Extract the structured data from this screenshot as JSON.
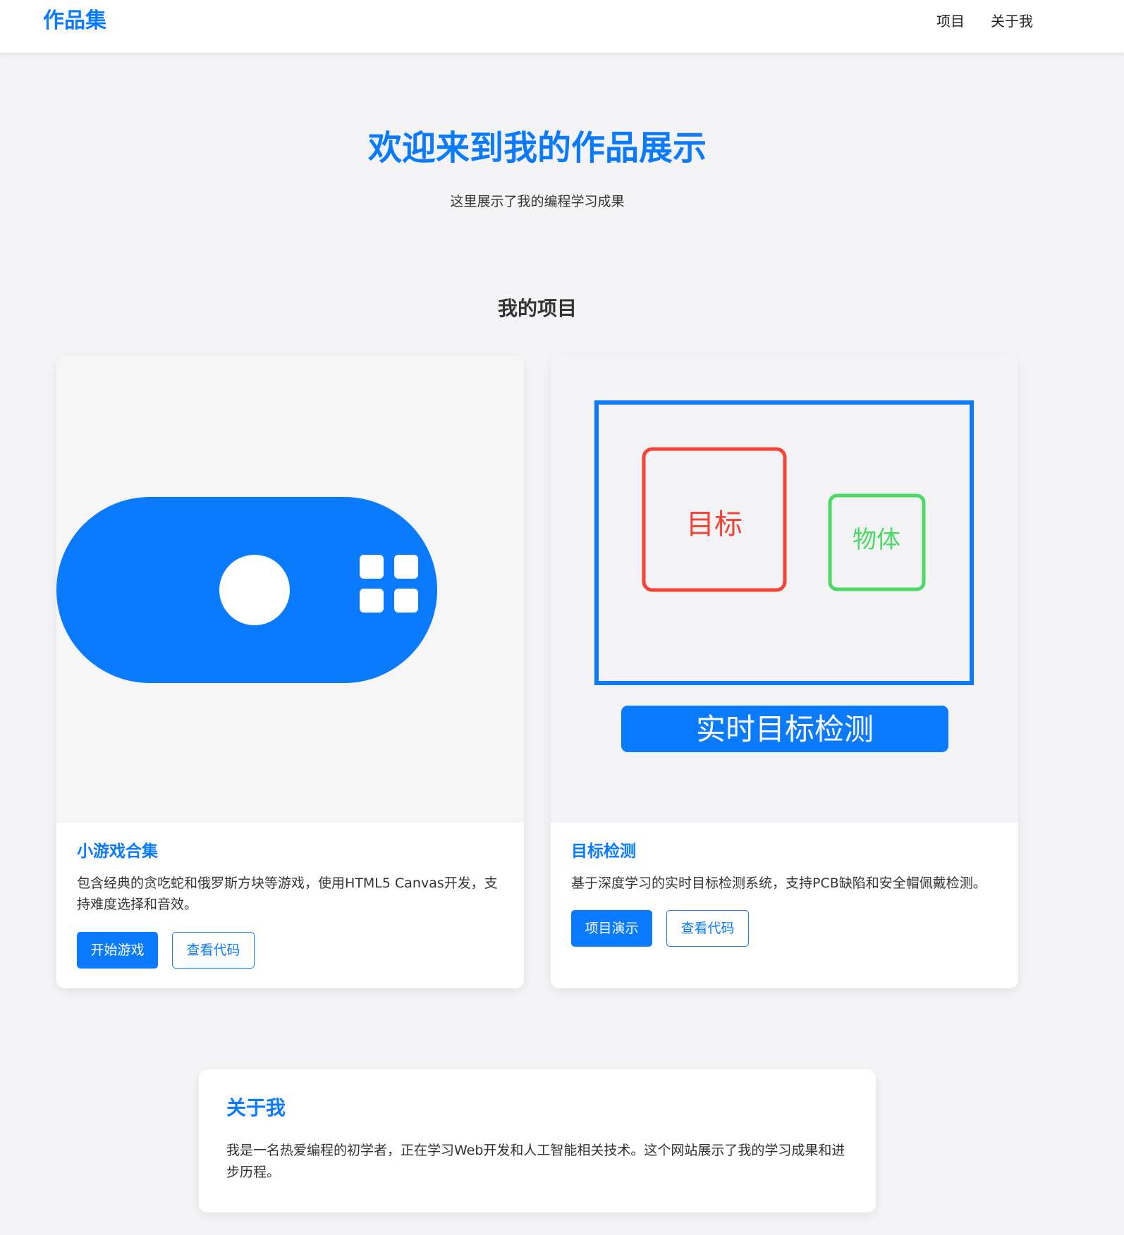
{
  "header": {
    "brand": "作品集",
    "nav": {
      "projects": "项目",
      "about": "关于我"
    }
  },
  "hero": {
    "title": "欢迎来到我的作品展示",
    "subtitle": "这里展示了我的编程学习成果"
  },
  "projects_section": {
    "title": "我的项目",
    "cards": [
      {
        "image_icon": "gamepad-icon",
        "title": "小游戏合集",
        "description": "包含经典的贪吃蛇和俄罗斯方块等游戏，使用HTML5 Canvas开发，支持难度选择和音效。",
        "primary_button": "开始游戏",
        "secondary_button": "查看代码"
      },
      {
        "image_icon": "object-detection-illustration",
        "illustration": {
          "target_label": "目标",
          "object_label": "物体",
          "banner": "实时目标检测"
        },
        "title": "目标检测",
        "description": "基于深度学习的实时目标检测系统，支持PCB缺陷和安全帽佩戴检测。",
        "primary_button": "项目演示",
        "secondary_button": "查看代码"
      }
    ]
  },
  "about": {
    "title": "关于我",
    "text": "我是一名热爱编程的初学者，正在学习Web开发和人工智能相关技术。这个网站展示了我的学习成果和进步历程。"
  },
  "colors": {
    "accent": "#0a7bff",
    "background": "#f4f4f6",
    "target_box": "#f44336",
    "object_box": "#4cd964"
  }
}
